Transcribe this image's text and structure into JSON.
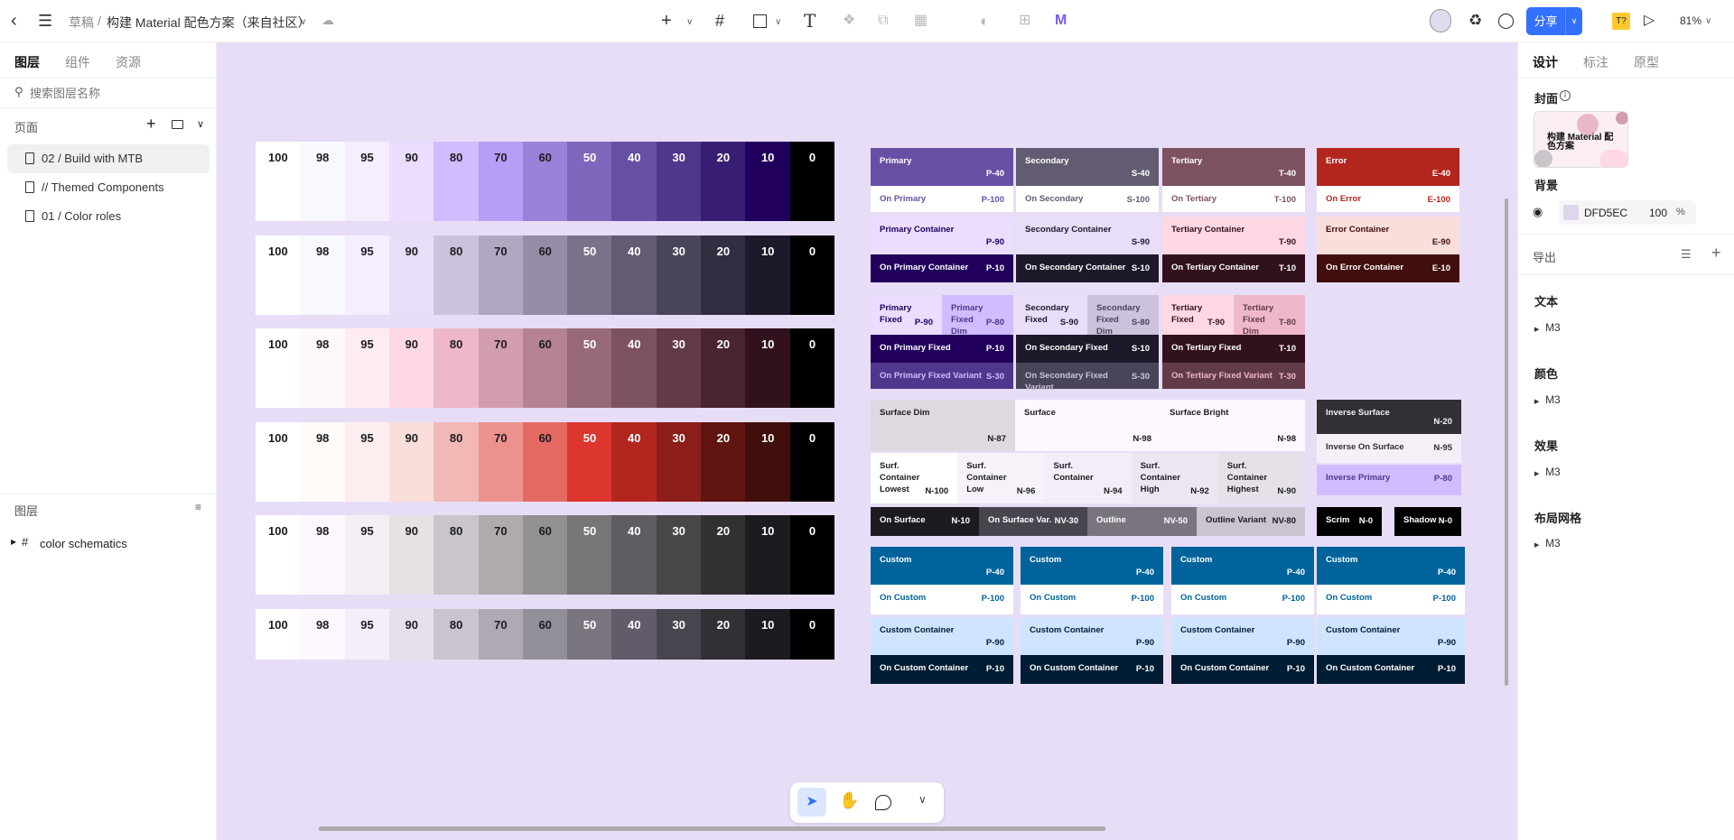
{
  "topbar": {
    "breadcrumb_root": "草稿",
    "separator": "/",
    "file_title": "构建 Material 配色方案（来自社区）",
    "share_label": "分享",
    "zoom": "81%",
    "font_badge": "T?"
  },
  "left_panel": {
    "tabs": [
      "图层",
      "组件",
      "资源"
    ],
    "search_placeholder": "搜索图层名称",
    "pages_title": "页面",
    "pages": [
      "02 / Build with MTB",
      "// Themed Components",
      "01 / Color roles"
    ],
    "layers_title": "图层",
    "layers": [
      "color schematics"
    ]
  },
  "right_panel": {
    "tabs": [
      "设计",
      "标注",
      "原型"
    ],
    "cover_title": "封面",
    "cover_text": "构建 Material 配色方案",
    "background_title": "背景",
    "background_hex": "DFD5EC",
    "background_opacity": "100",
    "percent": "%",
    "export_title": "导出",
    "sections": [
      {
        "title": "文本",
        "item": "M3"
      },
      {
        "title": "颜色",
        "item": "M3"
      },
      {
        "title": "效果",
        "item": "M3"
      },
      {
        "title": "布局网格",
        "item": "M3"
      }
    ]
  },
  "canvas": {
    "background": "#e8ddf6",
    "tones": [
      "100",
      "98",
      "95",
      "90",
      "80",
      "70",
      "60",
      "50",
      "40",
      "30",
      "20",
      "10",
      "0"
    ],
    "palettes": [
      [
        "#FFFFFF",
        "#F8F9FF",
        "#F6EDFF",
        "#EADDFF",
        "#D0BCFF",
        "#B69DF8",
        "#9A82DB",
        "#7F67BE",
        "#6750A4",
        "#4F378B",
        "#381E72",
        "#21005D",
        "#000000"
      ],
      [
        "#FFFFFF",
        "#F8F9FF",
        "#F6EDFF",
        "#E8DEF8",
        "#CCC2DC",
        "#B0A7C0",
        "#958DA5",
        "#7A7289",
        "#625B71",
        "#4A4458",
        "#332D41",
        "#1D192B",
        "#000000"
      ],
      [
        "#FFFFFF",
        "#FFF8F9",
        "#FFECF1",
        "#FFD8E4",
        "#EFB8C8",
        "#D29DAC",
        "#B58392",
        "#986977",
        "#7D5260",
        "#633B48",
        "#492532",
        "#31111D",
        "#000000"
      ],
      [
        "#FFFFFF",
        "#FFFBF9",
        "#FCEEEE",
        "#F9DEDC",
        "#F2B8B5",
        "#EC928E",
        "#E46962",
        "#DC362E",
        "#B3261E",
        "#8C1D18",
        "#601410",
        "#410E0B",
        "#000000"
      ],
      [
        "#FFFFFF",
        "#FEF7FF",
        "#F4EFF4",
        "#E6E1E5",
        "#C9C5CA",
        "#AEAAAE",
        "#939094",
        "#787579",
        "#605D62",
        "#484649",
        "#313033",
        "#1C1B1F",
        "#000000"
      ],
      [
        "#FFFFFF",
        "#FEF7FF",
        "#F5EEFA",
        "#E7E0EC",
        "#CAC4D0",
        "#AEA9B4",
        "#938F99",
        "#79747E",
        "#625B6A",
        "#49454F",
        "#322F35",
        "#1D1A22",
        "#000000"
      ]
    ],
    "roles": [
      {
        "label": "Primary",
        "tone": "P-40",
        "bg": "#6750A4",
        "fg": "#FFFFFF"
      },
      {
        "label": "On Primary",
        "tone": "P-100",
        "bg": "#FFFFFF",
        "fg": "#6750A4"
      },
      {
        "label": "Primary Container",
        "tone": "P-90",
        "bg": "#EADDFF",
        "fg": "#21005D"
      },
      {
        "label": "On Primary Container",
        "tone": "P-10",
        "bg": "#21005D",
        "fg": "#FFFFFF"
      },
      {
        "label": "Secondary",
        "tone": "S-40",
        "bg": "#625B71",
        "fg": "#FFFFFF"
      },
      {
        "label": "On Secondary",
        "tone": "S-100",
        "bg": "#FFFFFF",
        "fg": "#625B71"
      },
      {
        "label": "Secondary Container",
        "tone": "S-90",
        "bg": "#E8DEF8",
        "fg": "#1D192B"
      },
      {
        "label": "On Secondary Container",
        "tone": "S-10",
        "bg": "#1D192B",
        "fg": "#FFFFFF"
      },
      {
        "label": "Tertiary",
        "tone": "T-40",
        "bg": "#7D5260",
        "fg": "#FFFFFF"
      },
      {
        "label": "On Tertiary",
        "tone": "T-100",
        "bg": "#FFFFFF",
        "fg": "#7D5260"
      },
      {
        "label": "Tertiary Container",
        "tone": "T-90",
        "bg": "#FFD8E4",
        "fg": "#31111D"
      },
      {
        "label": "On Tertiary Container",
        "tone": "T-10",
        "bg": "#31111D",
        "fg": "#FFFFFF"
      },
      {
        "label": "Error",
        "tone": "E-40",
        "bg": "#B3261E",
        "fg": "#FFFFFF"
      },
      {
        "label": "On Error",
        "tone": "E-100",
        "bg": "#FFFFFF",
        "fg": "#B3261E"
      },
      {
        "label": "Error Container",
        "tone": "E-90",
        "bg": "#F9DEDC",
        "fg": "#410E0B"
      },
      {
        "label": "On Error Container",
        "tone": "E-10",
        "bg": "#410E0B",
        "fg": "#FFFFFF"
      },
      {
        "label": "Primary Fixed",
        "tone": "P-90",
        "bg": "#EADDFF",
        "fg": "#21005D"
      },
      {
        "label": "Primary Fixed Dim",
        "tone": "P-80",
        "bg": "#D0BCFF",
        "fg": "#4F378B"
      },
      {
        "label": "On Primary Fixed",
        "tone": "P-10",
        "bg": "#21005D",
        "fg": "#FFFFFF"
      },
      {
        "label": "On Primary Fixed Variant",
        "tone": "S-30",
        "bg": "#4F378B",
        "fg": "#D0BCFF"
      },
      {
        "label": "Secondary Fixed",
        "tone": "S-90",
        "bg": "#E8DEF8",
        "fg": "#1D192B"
      },
      {
        "label": "Secondary Fixed Dim",
        "tone": "S-80",
        "bg": "#CCC2DC",
        "fg": "#4A4458"
      },
      {
        "label": "On Secondary Fixed",
        "tone": "S-10",
        "bg": "#1D192B",
        "fg": "#FFFFFF"
      },
      {
        "label": "On Secondary Fixed Variant",
        "tone": "S-30",
        "bg": "#4A4458",
        "fg": "#CCC2DC"
      },
      {
        "label": "Tertiary Fixed",
        "tone": "T-90",
        "bg": "#FFD8E4",
        "fg": "#31111D"
      },
      {
        "label": "Tertiary Fixed Dim",
        "tone": "T-80",
        "bg": "#EFB8C8",
        "fg": "#633B48"
      },
      {
        "label": "On Tertiary Fixed",
        "tone": "T-10",
        "bg": "#31111D",
        "fg": "#FFFFFF"
      },
      {
        "label": "On Tertiary Fixed Variant",
        "tone": "T-30",
        "bg": "#633B48",
        "fg": "#EFB8C8"
      },
      {
        "label": "Surface Dim",
        "tone": "N-87",
        "bg": "#DED8E1",
        "fg": "#1D1B20"
      },
      {
        "label": "Surface",
        "tone": "N-98",
        "bg": "#FEF7FF",
        "fg": "#1D1B20"
      },
      {
        "label": "Surface Bright",
        "tone": "N-98",
        "bg": "#FEF7FF",
        "fg": "#1D1B20"
      },
      {
        "label": "Surf. Container Lowest",
        "tone": "N-100",
        "bg": "#FFFFFF",
        "fg": "#1D1B20"
      },
      {
        "label": "Surf. Container Low",
        "tone": "N-96",
        "bg": "#F7F2FA",
        "fg": "#1D1B20"
      },
      {
        "label": "Surf. Container",
        "tone": "N-94",
        "bg": "#F3EDF7",
        "fg": "#1D1B20"
      },
      {
        "label": "Surf. Container High",
        "tone": "N-92",
        "bg": "#ECE6F0",
        "fg": "#1D1B20"
      },
      {
        "label": "Surf. Container Highest",
        "tone": "N-90",
        "bg": "#E6E0E9",
        "fg": "#1D1B20"
      },
      {
        "label": "On Surface",
        "tone": "N-10",
        "bg": "#1D1B20",
        "fg": "#FFFFFF"
      },
      {
        "label": "On Surface Var.",
        "tone": "NV-30",
        "bg": "#49454F",
        "fg": "#FFFFFF"
      },
      {
        "label": "Outline",
        "tone": "NV-50",
        "bg": "#79747E",
        "fg": "#FFFFFF"
      },
      {
        "label": "Outline Variant",
        "tone": "NV-80",
        "bg": "#CAC4D0",
        "fg": "#1D1B20"
      },
      {
        "label": "Inverse Surface",
        "tone": "N-20",
        "bg": "#322F35",
        "fg": "#F5EFF7"
      },
      {
        "label": "Inverse On Surface",
        "tone": "N-95",
        "bg": "#F5EFF7",
        "fg": "#322F35"
      },
      {
        "label": "Inverse Primary",
        "tone": "P-80",
        "bg": "#D0BCFF",
        "fg": "#4F378B"
      },
      {
        "label": "Scrim",
        "tone": "N-0",
        "bg": "#000000",
        "fg": "#FFFFFF"
      },
      {
        "label": "Shadow",
        "tone": "N-0",
        "bg": "#000000",
        "fg": "#FFFFFF"
      },
      {
        "label": "Custom",
        "tone": "P-40",
        "bg": "#00639B",
        "fg": "#FFFFFF"
      },
      {
        "label": "On Custom",
        "tone": "P-100",
        "bg": "#FFFFFF",
        "fg": "#00639B"
      },
      {
        "label": "Custom Container",
        "tone": "P-90",
        "bg": "#CFE5FF",
        "fg": "#001D33"
      },
      {
        "label": "On Custom Container",
        "tone": "P-10",
        "bg": "#001D33",
        "fg": "#FFFFFF"
      },
      {
        "label": "Custom",
        "tone": "P-40",
        "bg": "#00639B",
        "fg": "#FFFFFF"
      },
      {
        "label": "On Custom",
        "tone": "P-100",
        "bg": "#FFFFFF",
        "fg": "#00639B"
      },
      {
        "label": "Custom Container",
        "tone": "P-90",
        "bg": "#CFE5FF",
        "fg": "#001D33"
      },
      {
        "label": "On Custom Container",
        "tone": "P-10",
        "bg": "#001D33",
        "fg": "#FFFFFF"
      },
      {
        "label": "Custom",
        "tone": "P-40",
        "bg": "#00639B",
        "fg": "#FFFFFF"
      },
      {
        "label": "On Custom",
        "tone": "P-100",
        "bg": "#FFFFFF",
        "fg": "#00639B"
      },
      {
        "label": "Custom Container",
        "tone": "P-90",
        "bg": "#CFE5FF",
        "fg": "#001D33"
      },
      {
        "label": "On Custom Container",
        "tone": "P-10",
        "bg": "#001D33",
        "fg": "#FFFFFF"
      },
      {
        "label": "Custom",
        "tone": "P-40",
        "bg": "#00639B",
        "fg": "#FFFFFF"
      },
      {
        "label": "On Custom",
        "tone": "P-100",
        "bg": "#FFFFFF",
        "fg": "#00639B"
      },
      {
        "label": "Custom Container",
        "tone": "P-90",
        "bg": "#CFE5FF",
        "fg": "#001D33"
      },
      {
        "label": "On Custom Container",
        "tone": "P-10",
        "bg": "#001D33",
        "fg": "#FFFFFF"
      }
    ]
  },
  "colors": {
    "accent": "#3370ff",
    "badge": "#ffc82c"
  }
}
